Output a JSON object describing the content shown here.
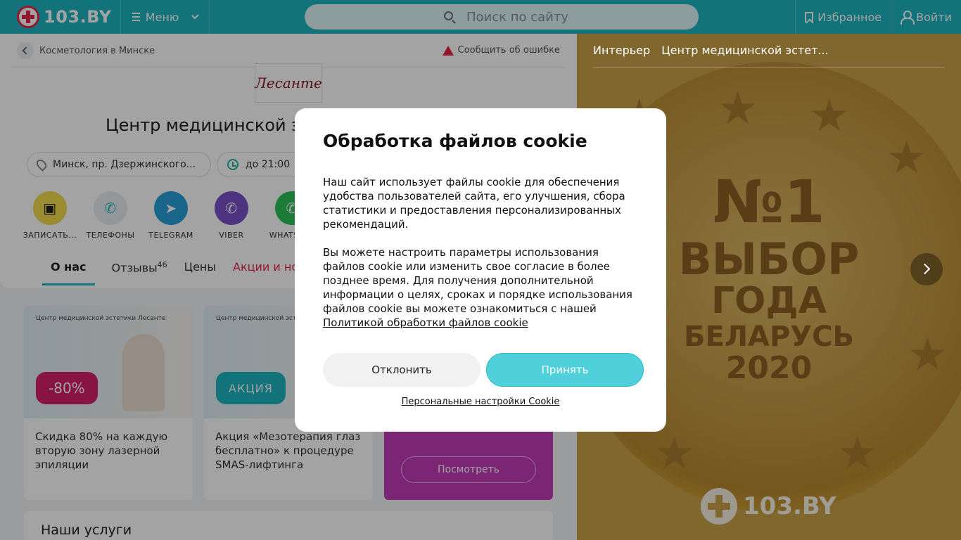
{
  "header": {
    "logo_text": "103.BY",
    "menu_label": "Меню",
    "search_placeholder": "Поиск по сайту",
    "favorites_label": "Избранное",
    "login_label": "Войти"
  },
  "breadcrumb": {
    "label": "Косметология в Минске"
  },
  "report_label": "Сообщить об ошибке",
  "clinic": {
    "logo_text": "Лесанте",
    "title": "Центр медицинской эстетики Лесанте",
    "address": "Минск, пр. Дзержинского...",
    "hours": "до 21:00"
  },
  "actions": [
    {
      "label": "ЗАПИСАТЬ...",
      "icon": "calendar-icon",
      "color": "#f2d94e"
    },
    {
      "label": "ТЕЛЕФОНЫ",
      "icon": "phone-icon",
      "color": "#e8ecef"
    },
    {
      "label": "TELEGRAM",
      "icon": "telegram-icon",
      "color": "#2a9fd8"
    },
    {
      "label": "VIBER",
      "icon": "viber-icon",
      "color": "#7b52c9"
    },
    {
      "label": "WHATSAPP",
      "icon": "whatsapp-icon",
      "color": "#2ec15a"
    }
  ],
  "tabs": {
    "about": "О нас",
    "reviews": "Отзывы",
    "reviews_count": "46",
    "prices": "Цены",
    "promos": "Акции и новости"
  },
  "promos": [
    {
      "brand": "Центр медицинской эстетики Лесанте",
      "badge": "-80%",
      "text": "Скидка 80% на каждую вторую зону лазерной эпиляции"
    },
    {
      "brand": "Центр медицинской эстетики Лесанте",
      "badge": "АКЦИЯ",
      "text": "Акция «Мезотерапия глаз бесплатно» к процедуре SMAS-лифтинга"
    }
  ],
  "promo_view_label": "Посмотреть",
  "services_title": "Наши услуги",
  "gallery": {
    "tab_interior": "Интерьер",
    "tab_center": "Центр медицинской эстет...",
    "medal_line1": "№1",
    "medal_line2": "ВЫБОР",
    "medal_line3": "ГОДА",
    "medal_line4": "БЕЛАРУСЬ",
    "medal_line5": "2020",
    "watermark": "103.BY"
  },
  "cookie": {
    "title": "Обработка файлов cookie",
    "paragraph1": "Наш сайт использует файлы cookie для обеспечения удобства пользователей сайта, его улучшения, сбора статистики и предоставления персонализированных рекомендаций.",
    "paragraph2": "Вы можете настроить параметры использования файлов cookie или изменить свое согласие в более позднее время. Для получения дополнительной информации о целях, сроках и порядке использования файлов cookie вы можете ознакомиться с нашей",
    "policy_link": "Политикой обработки файлов cookie",
    "decline_label": "Отклонить",
    "accept_label": "Принять",
    "personal_settings_label": "Персональные настройки Cookie"
  }
}
